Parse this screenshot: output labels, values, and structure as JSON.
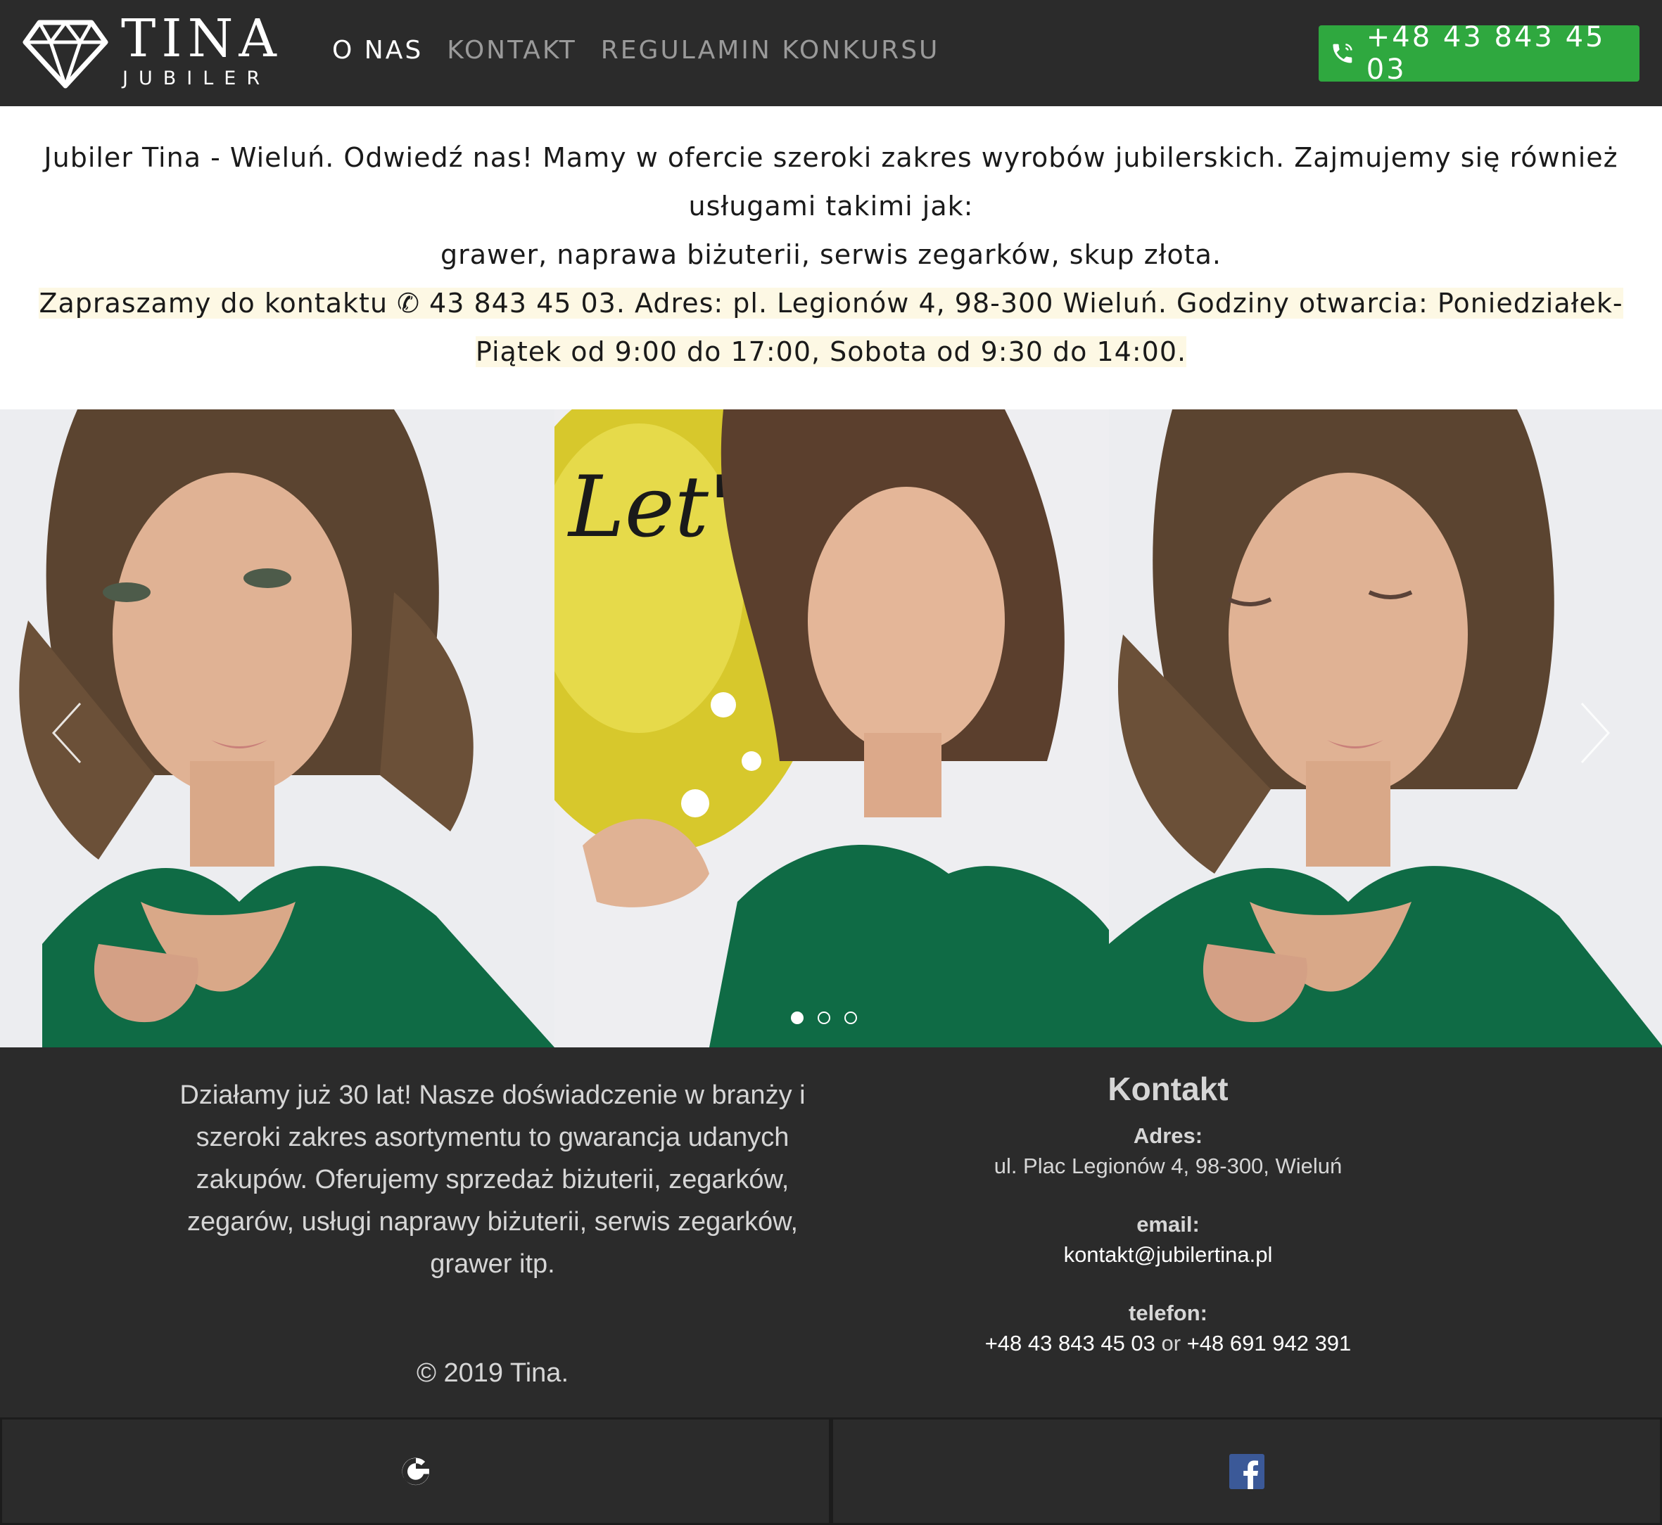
{
  "brand": {
    "name": "TINA",
    "tagline": "JUBILER"
  },
  "nav": [
    {
      "label": "O NAS",
      "active": true
    },
    {
      "label": "KONTAKT",
      "active": false
    },
    {
      "label": "REGULAMIN KONKURSU",
      "active": false
    }
  ],
  "phone_button": {
    "label": "+48 43 843 45 03",
    "icon": "phone-icon",
    "color": "#2fa83f"
  },
  "intro": {
    "line1": "Jubiler Tina - Wieluń. Odwiedź nas! Mamy w ofercie szeroki zakres wyrobów jubilerskich. Zajmujemy się również usługami takimi jak:",
    "line2": "grawer, naprawa biżuterii, serwis zegarków, skup złota.",
    "line3": "Zapraszamy do kontaktu ✆ 43 843 45 03. Adres: pl. Legionów 4, 98-300 Wieluń. Godziny otwarcia: Poniedziałek-Piątek od 9:00 do 17:00, Sobota od 9:30 do 14:00."
  },
  "carousel": {
    "active_index": 0,
    "slides": 3,
    "balloon_text": "Let's Party",
    "prev_icon": "chevron-left-icon",
    "next_icon": "chevron-right-icon"
  },
  "footer": {
    "about": "Działamy już 30 lat! Nasze doświadczenie w branży i szeroki zakres asortymentu to gwarancja udanych zakupów. Oferujemy sprzedaż biżuterii, zegarków, zegarów, usługi naprawy biżuterii, serwis zegarków, grawer itp.",
    "copyright": "©  2019 Tina.",
    "contact": {
      "title": "Kontakt",
      "address_label": "Adres:",
      "address": "ul. Plac Legionów 4, 98-300, Wieluń",
      "email_label": "email:",
      "email": "kontakt@jubilertina.pl",
      "phone_label": "telefon:",
      "phone1": "+48 43 843 45 03",
      "or": " or ",
      "phone2": "+48 691 942 391"
    }
  },
  "social": [
    {
      "name": "google",
      "icon": "google-icon"
    },
    {
      "name": "facebook",
      "icon": "facebook-icon",
      "color": "#3b5998"
    }
  ],
  "colors": {
    "header_bg": "#2b2b2b",
    "highlight_bg": "#fdf8e4",
    "dress_green": "#0f6b45"
  }
}
